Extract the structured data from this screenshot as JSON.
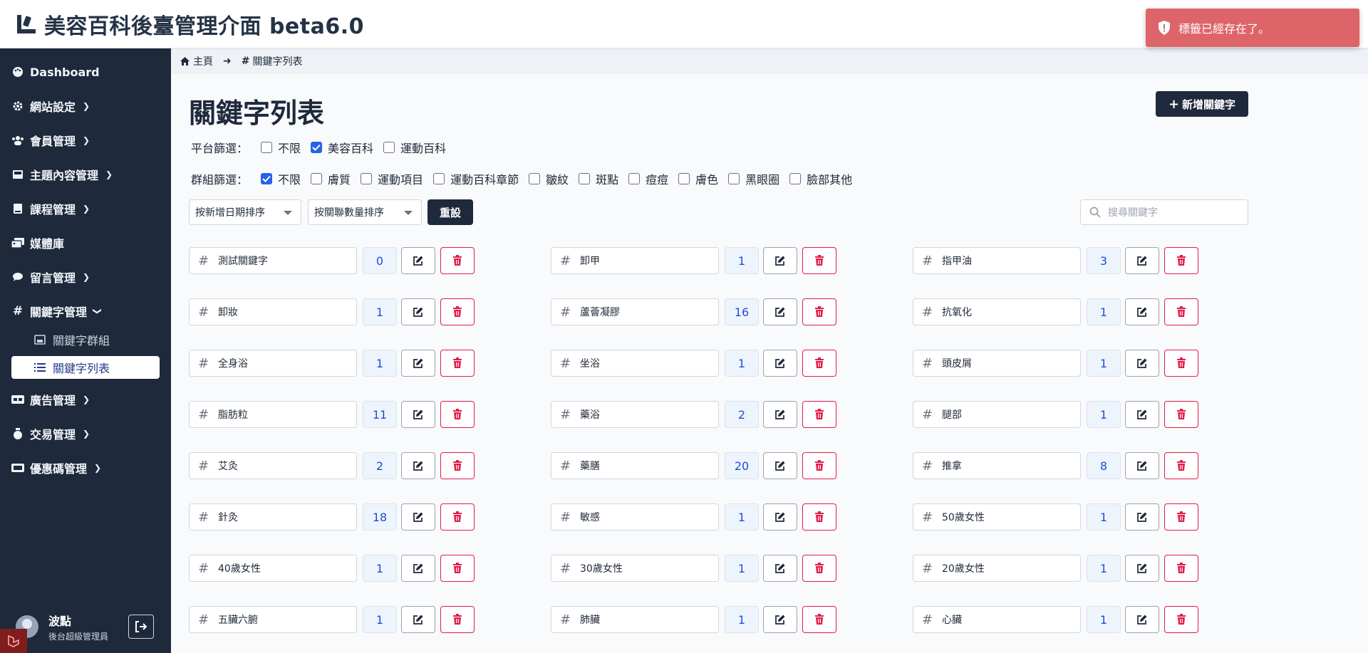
{
  "header": {
    "title": "美容百科後臺管理介面 beta6.0"
  },
  "toast": {
    "message": "標籤已經存在了。"
  },
  "sidebar": {
    "items": [
      {
        "label": "Dashboard",
        "icon": "palette-icon",
        "expand": false
      },
      {
        "label": "網站設定",
        "icon": "gear-icon",
        "expand": true
      },
      {
        "label": "會員管理",
        "icon": "users-icon",
        "expand": true
      },
      {
        "label": "主題內容管理",
        "icon": "book-icon",
        "expand": true
      },
      {
        "label": "課程管理",
        "icon": "book-icon",
        "expand": true
      },
      {
        "label": "媒體庫",
        "icon": "images-icon",
        "expand": false
      },
      {
        "label": "留言管理",
        "icon": "comment-icon",
        "expand": true
      },
      {
        "label": "關鍵字管理",
        "icon": "hashtag-icon",
        "expand": true
      },
      {
        "label": "廣告管理",
        "icon": "ad-icon",
        "expand": true
      },
      {
        "label": "交易管理",
        "icon": "money-bag-icon",
        "expand": true
      },
      {
        "label": "優惠碼管理",
        "icon": "ticket-icon",
        "expand": true
      }
    ],
    "subitems": [
      {
        "label": "關鍵字群組"
      },
      {
        "label": "關鍵字列表"
      }
    ]
  },
  "user": {
    "name": "波點",
    "role": "後台超級管理員"
  },
  "breadcrumb": {
    "home": "主頁",
    "current": "關鍵字列表"
  },
  "page": {
    "title": "關鍵字列表",
    "add_label": "新增關鍵字"
  },
  "filters": {
    "platform_label": "平台篩選：",
    "platform": [
      {
        "label": "不限",
        "checked": false
      },
      {
        "label": "美容百科",
        "checked": true
      },
      {
        "label": "運動百科",
        "checked": false
      }
    ],
    "group_label": "群組篩選：",
    "group": [
      {
        "label": "不限",
        "checked": true
      },
      {
        "label": "膚質",
        "checked": false
      },
      {
        "label": "運動項目",
        "checked": false
      },
      {
        "label": "運動百科章節",
        "checked": false
      },
      {
        "label": "皺紋",
        "checked": false
      },
      {
        "label": "斑點",
        "checked": false
      },
      {
        "label": "痘痘",
        "checked": false
      },
      {
        "label": "膚色",
        "checked": false
      },
      {
        "label": "黑眼圈",
        "checked": false
      },
      {
        "label": "臉部其他",
        "checked": false
      }
    ]
  },
  "sort": {
    "by_date": "按新增日期排序",
    "by_count": "按關聯數量排序",
    "reset": "重設"
  },
  "search": {
    "placeholder": "搜尋關鍵字"
  },
  "keywords": [
    {
      "name": "測試關鍵字",
      "count": "0"
    },
    {
      "name": "卸甲",
      "count": "1"
    },
    {
      "name": "指甲油",
      "count": "3"
    },
    {
      "name": "卸妝",
      "count": "1"
    },
    {
      "name": "蘆薈凝膠",
      "count": "16"
    },
    {
      "name": "抗氧化",
      "count": "1"
    },
    {
      "name": "全身浴",
      "count": "1"
    },
    {
      "name": "坐浴",
      "count": "1"
    },
    {
      "name": "頭皮屑",
      "count": "1"
    },
    {
      "name": "脂肪粒",
      "count": "11"
    },
    {
      "name": "藥浴",
      "count": "2"
    },
    {
      "name": "腿部",
      "count": "1"
    },
    {
      "name": "艾灸",
      "count": "2"
    },
    {
      "name": "藥膳",
      "count": "20"
    },
    {
      "name": "推拿",
      "count": "8"
    },
    {
      "name": "針灸",
      "count": "18"
    },
    {
      "name": "敏感",
      "count": "1"
    },
    {
      "name": "50歲女性",
      "count": "1"
    },
    {
      "name": "40歲女性",
      "count": "1"
    },
    {
      "name": "30歲女性",
      "count": "1"
    },
    {
      "name": "20歲女性",
      "count": "1"
    },
    {
      "name": "五臟六腑",
      "count": "1"
    },
    {
      "name": "肺臟",
      "count": "1"
    },
    {
      "name": "心臟",
      "count": "1"
    }
  ]
}
